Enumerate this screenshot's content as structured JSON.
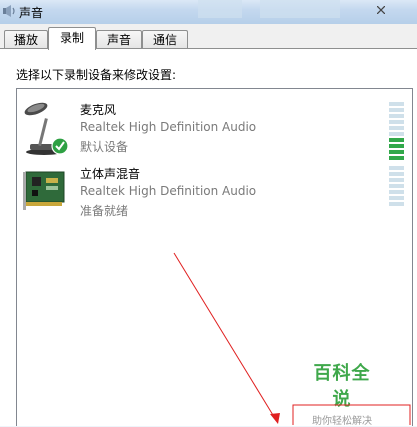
{
  "window": {
    "title": "声音"
  },
  "tabs": [
    {
      "label": "播放",
      "active": false
    },
    {
      "label": "录制",
      "active": true
    },
    {
      "label": "声音",
      "active": false
    },
    {
      "label": "通信",
      "active": false
    }
  ],
  "instruction": "选择以下录制设备来修改设置:",
  "devices": [
    {
      "name": "麦克风",
      "driver": "Realtek High Definition Audio",
      "status": "默认设备",
      "icon": "microphone-icon",
      "is_default": true,
      "meter_level_bars": 4
    },
    {
      "name": "立体声混音",
      "driver": "Realtek High Definition Audio",
      "status": "准备就绪",
      "icon": "sound-card-icon",
      "is_default": false,
      "meter_level_bars": 0
    }
  ],
  "watermark": {
    "title": "百科全说",
    "subtitle": "助你轻松解决"
  },
  "colors": {
    "accent_green": "#31a84a",
    "annotation_red": "#e02020",
    "watermark_green": "#3fa84b"
  }
}
